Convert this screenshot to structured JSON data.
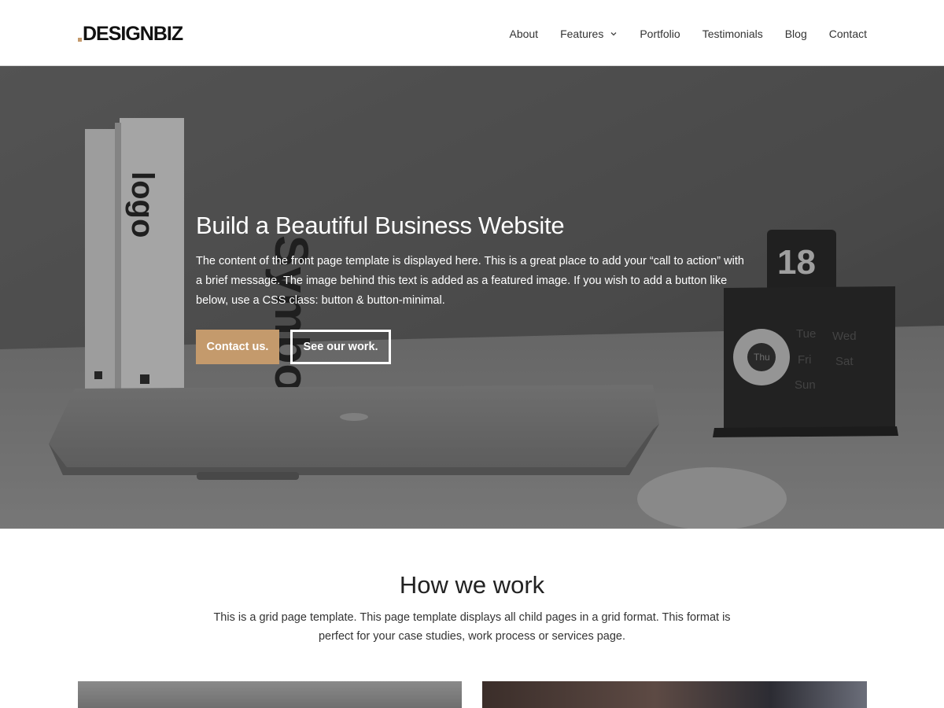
{
  "header": {
    "logo_text": "DESIGNBIZ",
    "logo_dot_color": "#c49a6c",
    "nav": [
      {
        "label": "About"
      },
      {
        "label": "Features",
        "has_dropdown": true
      },
      {
        "label": "Portfolio"
      },
      {
        "label": "Testimonials"
      },
      {
        "label": "Blog"
      },
      {
        "label": "Contact"
      }
    ]
  },
  "hero": {
    "title": "Build a Beautiful Business Website",
    "text": "The content of the front page template is displayed here. This is a great place to add your “call to action” with a brief message. The image behind this text is added as a featured image. If you wish to add a button like below, use a CSS class: button & button-minimal.",
    "primary_button": "Contact us.",
    "secondary_button": "See our work.",
    "accent_color": "#c49a6c",
    "image": {
      "book_spine_text": "Symbol",
      "book_logo_text": "logo",
      "calendar_number": "18",
      "calendar_days": [
        "Tue",
        "Wed",
        "Thu",
        "Fri",
        "Sat",
        "Sun"
      ]
    }
  },
  "section": {
    "title": "How we work",
    "text": "This is a grid page template. This page template displays all child pages in a grid format. This format is perfect for your case studies, work process or services page."
  }
}
